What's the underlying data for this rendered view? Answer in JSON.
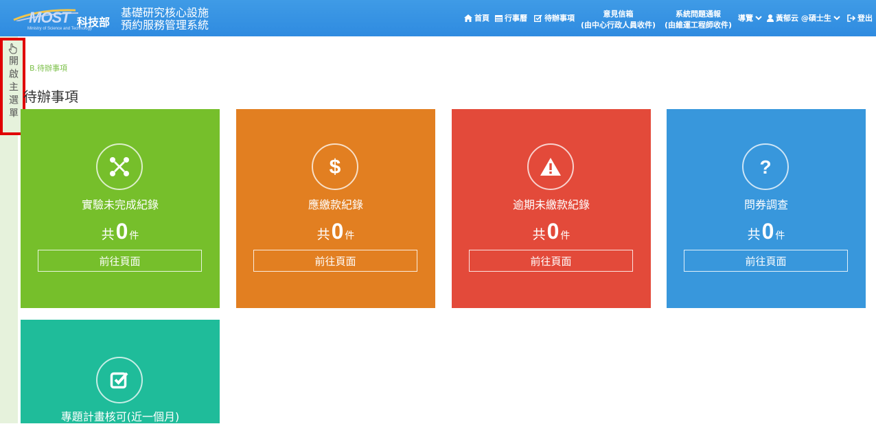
{
  "header": {
    "logo_text": "MOST",
    "logo_cn": "科技部",
    "logo_sub": "Ministry of Science and Technology",
    "site_title_line1": "基礎研究核心設施",
    "site_title_line2": "預約服務管理系統",
    "nav": {
      "home": "首頁",
      "calendar": "行事曆",
      "todo": "待辦事項",
      "feedback_line1": "意見信箱",
      "feedback_line2": "(由中心行政人員收件)",
      "report_line1": "系統問題通報",
      "report_line2": "(由維運工程師收件)",
      "guide": "導覽",
      "user": "黃郁云 @碩士生",
      "logout": "登出"
    }
  },
  "sidebar": {
    "toggle_label": "開啟主選單"
  },
  "breadcrumb": "B.待辦事項",
  "page_title": "待辦事項",
  "tiles": [
    {
      "label": "實驗未完成紀錄",
      "prefix": "共",
      "count": "0",
      "unit": "件",
      "button": "前往頁面",
      "color": "#76bf2b",
      "icon": "joomla-icon"
    },
    {
      "label": "應繳款紀錄",
      "prefix": "共",
      "count": "0",
      "unit": "件",
      "button": "前往頁面",
      "color": "#e27f21",
      "icon": "dollar-icon"
    },
    {
      "label": "逾期未繳款紀錄",
      "prefix": "共",
      "count": "0",
      "unit": "件",
      "button": "前往頁面",
      "color": "#e34a3a",
      "icon": "warning-icon"
    },
    {
      "label": "問券調查",
      "prefix": "共",
      "count": "0",
      "unit": "件",
      "button": "前往頁面",
      "color": "#3897dc",
      "icon": "question-icon"
    },
    {
      "label": "專題計畫核可(近一個月)",
      "color": "#1fbc9a",
      "icon": "check-square-icon"
    }
  ]
}
